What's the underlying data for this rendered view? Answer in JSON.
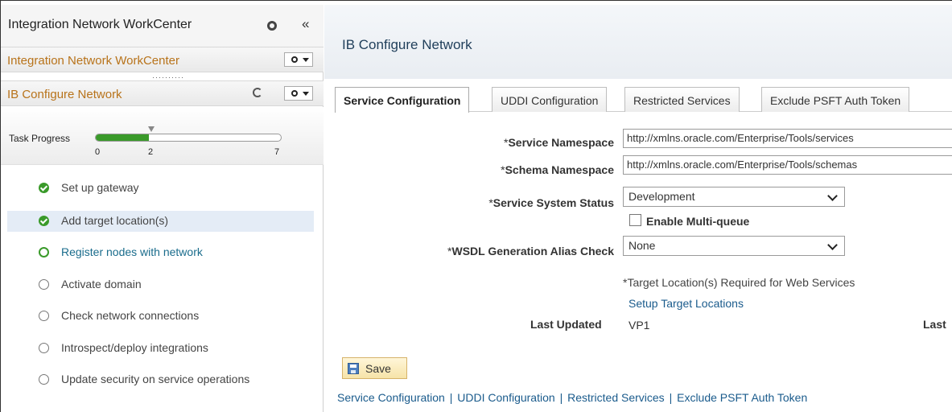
{
  "workcenter": {
    "title": "Integration Network WorkCenter",
    "pagelet_title": "Integration Network WorkCenter",
    "grip": "··········"
  },
  "section": {
    "title": "IB Configure Network"
  },
  "progress": {
    "label": "Task Progress",
    "current": 2,
    "min": 0,
    "max": 7,
    "ticks": [
      "0",
      "2",
      "7"
    ]
  },
  "tasks": [
    {
      "label": "Set up gateway",
      "status": "done"
    },
    {
      "label": "Add target location(s)",
      "status": "done"
    },
    {
      "label": "Register nodes with network",
      "status": "current"
    },
    {
      "label": "Activate domain",
      "status": "todo"
    },
    {
      "label": "Check network connections",
      "status": "todo"
    },
    {
      "label": "Introspect/deploy integrations",
      "status": "todo"
    },
    {
      "label": "Update security on service operations",
      "status": "todo"
    }
  ],
  "main": {
    "title": "IB Configure Network",
    "tabs": [
      {
        "label": "Service Configuration",
        "active": true
      },
      {
        "label": "UDDI Configuration",
        "active": false
      },
      {
        "label": "Restricted Services",
        "active": false
      },
      {
        "label": "Exclude PSFT Auth Token",
        "active": false
      }
    ],
    "service_namespace": {
      "label": "Service Namespace",
      "value": "http://xmlns.oracle.com/Enterprise/Tools/services"
    },
    "schema_namespace": {
      "label": "Schema Namespace",
      "value": "http://xmlns.oracle.com/Enterprise/Tools/schemas"
    },
    "service_system_status": {
      "label": "Service System Status",
      "value": "Development"
    },
    "multi_queue": {
      "label": "Enable Multi-queue",
      "checked": false
    },
    "wsdl_alias": {
      "label": "WSDL Generation Alias Check",
      "value": "None"
    },
    "required_marker": "*",
    "note": "*Target Location(s) Required for Web Services",
    "setup_link": "Setup Target Locations",
    "last_updated_label": "Last Updated",
    "last_updated_value": "VP1",
    "last_right": "Last",
    "save_label": "Save",
    "bottom_links": [
      "Service Configuration",
      "UDDI Configuration",
      "Restricted Services",
      "Exclude PSFT Auth Token"
    ],
    "bottom_separator": "|"
  },
  "colors": {
    "progress_green": "#3a9a2a",
    "pagelet_title": "#b8731a",
    "link": "#1a5b8c",
    "active_row": "#e4ecf6"
  }
}
